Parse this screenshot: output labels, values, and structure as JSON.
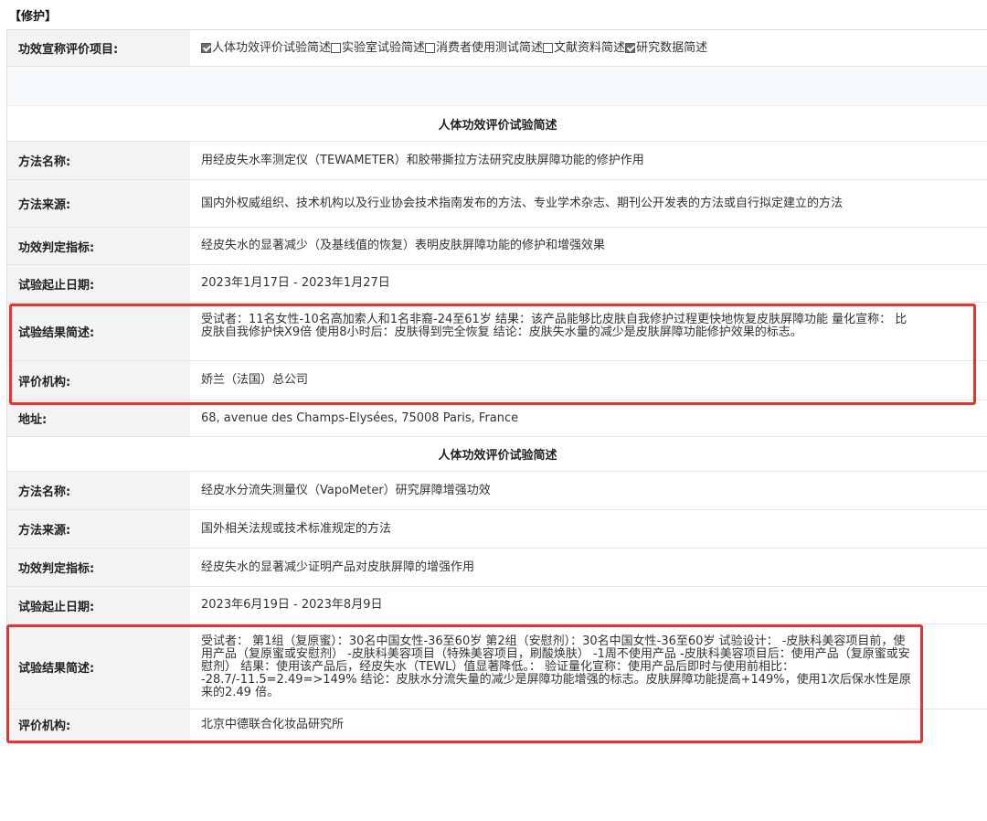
{
  "section_title": "【修护】",
  "claim": {
    "label": "功效宣称评价项目:",
    "options": [
      {
        "label": "人体功效评价试验简述",
        "checked": true
      },
      {
        "label": "实验室试验简述",
        "checked": false
      },
      {
        "label": "消费者使用测试简述",
        "checked": false
      },
      {
        "label": "文献资料简述",
        "checked": false
      },
      {
        "label": "研究数据简述",
        "checked": true
      }
    ]
  },
  "trial1": {
    "heading": "人体功效评价试验简述",
    "method_name": {
      "label": "方法名称:",
      "value": "用经皮失水率测定仪（TEWAMETER）和胶带撕拉方法研究皮肤屏障功能的修护作用"
    },
    "method_source": {
      "label": "方法来源:",
      "value": "国内外权威组织、技术机构以及行业协会技术指南发布的方法、专业学术杂志、期刊公开发表的方法或自行拟定建立的方法"
    },
    "indicator": {
      "label": "功效判定指标:",
      "value": "经皮失水的显著减少（及基线值的恢复）表明皮肤屏障功能的修护和增强效果"
    },
    "dates": {
      "label": "试验起止日期:",
      "value": "2023年1月17日 - 2023年1月27日"
    },
    "result": {
      "label": "试验结果简述:",
      "value": "受试者：11名女性-10名高加索人和1名非裔-24至61岁 结果：该产品能够比皮肤自我修护过程更快地恢复皮肤屏障功能 量化宣称： 比皮肤自我修护快X9倍 使用8小时后：皮肤得到完全恢复 结论：皮肤失水量的减少是皮肤屏障功能修护效果的标志。"
    },
    "institution": {
      "label": "评价机构:",
      "value": "娇兰（法国）总公司"
    },
    "address": {
      "label": "地址:",
      "value": "68, avenue des Champs-Elysées, 75008 Paris, France"
    }
  },
  "trial2": {
    "heading": "人体功效评价试验简述",
    "method_name": {
      "label": "方法名称:",
      "value": "经皮水分流失测量仪（VapoMeter）研究屏障增强功效"
    },
    "method_source": {
      "label": "方法来源:",
      "value": "国外相关法规或技术标准规定的方法"
    },
    "indicator": {
      "label": "功效判定指标:",
      "value": "经皮失水的显著减少证明产品对皮肤屏障的增强作用"
    },
    "dates": {
      "label": "试验起止日期:",
      "value": "2023年6月19日 - 2023年8月9日"
    },
    "result": {
      "label": "试验结果简述:",
      "value": "受试者： 第1组（复原蜜）：30名中国女性-36至60岁 第2组（安慰剂）：30名中国女性-36至60岁 试验设计： -皮肤科美容项目前，使用产品（复原蜜或安慰剂） -皮肤科美容项目（特殊美容项目，刷酸焕肤） -1周不使用产品 -皮肤科美容项目后：使用产品（复原蜜或安慰剂） 结果：使用该产品后，经皮失水（TEWL）值显著降低。： 验证量化宣称：使用产品后即时与使用前相比： -28.7/-11.5=2.49=>149% 结论：皮肤水分流失量的减少是屏障功能增强的标志。皮肤屏障功能提高+149%，使用1次后保水性是原来的2.49 倍。"
    },
    "institution": {
      "label": "评价机构:",
      "value": "北京中德联合化妆品研究所"
    }
  },
  "highlight_color": "#e8322e"
}
